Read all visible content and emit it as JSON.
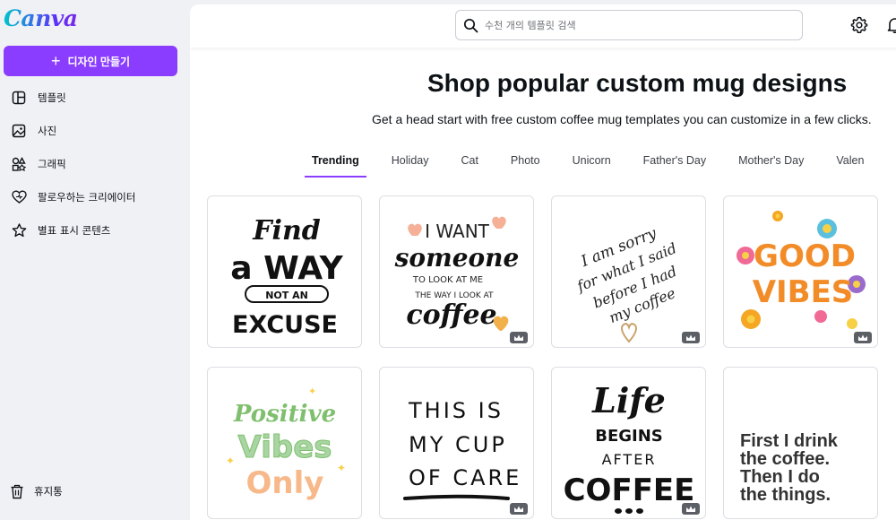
{
  "brand": {
    "logo_text": "Canva",
    "accent": "#8b3dff"
  },
  "sidebar": {
    "create_label": "디자인 만들기",
    "items": [
      {
        "label": "템플릿",
        "icon": "template-icon"
      },
      {
        "label": "사진",
        "icon": "image-icon"
      },
      {
        "label": "그래픽",
        "icon": "shapes-icon"
      },
      {
        "label": "팔로우하는 크리에이터",
        "icon": "heart-icon"
      },
      {
        "label": "별표 표시 콘텐츠",
        "icon": "star-icon"
      }
    ],
    "trash_label": "휴지통"
  },
  "topbar": {
    "search_placeholder": "수천 개의 템플릿 검색"
  },
  "main": {
    "title": "Shop popular custom mug designs",
    "subtitle": "Get a head start with free custom coffee mug templates you can customize in a few clicks.",
    "tabs": [
      "Trending",
      "Holiday",
      "Cat",
      "Photo",
      "Unicorn",
      "Father's Day",
      "Mother's Day",
      "Valen"
    ],
    "active_tab": "Trending"
  },
  "templates": [
    {
      "name": "find-a-way-not-an-excuse",
      "lines": [
        "Find",
        "a WAY",
        "NOT AN",
        "EXCUSE"
      ]
    },
    {
      "name": "i-want-someone-coffee",
      "lines": [
        "I WANT",
        "someone",
        "TO LOOK AT ME",
        "THE WAY I LOOK AT",
        "coffee"
      ]
    },
    {
      "name": "i-am-sorry-coffee",
      "lines": [
        "I am sorry",
        "for what I said",
        "before I had",
        "my coffee"
      ]
    },
    {
      "name": "good-vibes",
      "lines": [
        "GOOD",
        "VIBES"
      ]
    },
    {
      "name": "positive-vibes-only",
      "lines": [
        "Positive",
        "Vibes",
        "Only"
      ]
    },
    {
      "name": "this-is-my-cup-of-care",
      "lines": [
        "THIS IS",
        "MY CUP",
        "OF CARE"
      ]
    },
    {
      "name": "life-begins-after-coffee",
      "lines": [
        "Life",
        "BEGINS",
        "AFTER",
        "COFFEE"
      ]
    },
    {
      "name": "first-i-drink-the-coffee",
      "lines": [
        "First I drink",
        "the coffee.",
        "Then I do",
        "the things."
      ]
    }
  ]
}
